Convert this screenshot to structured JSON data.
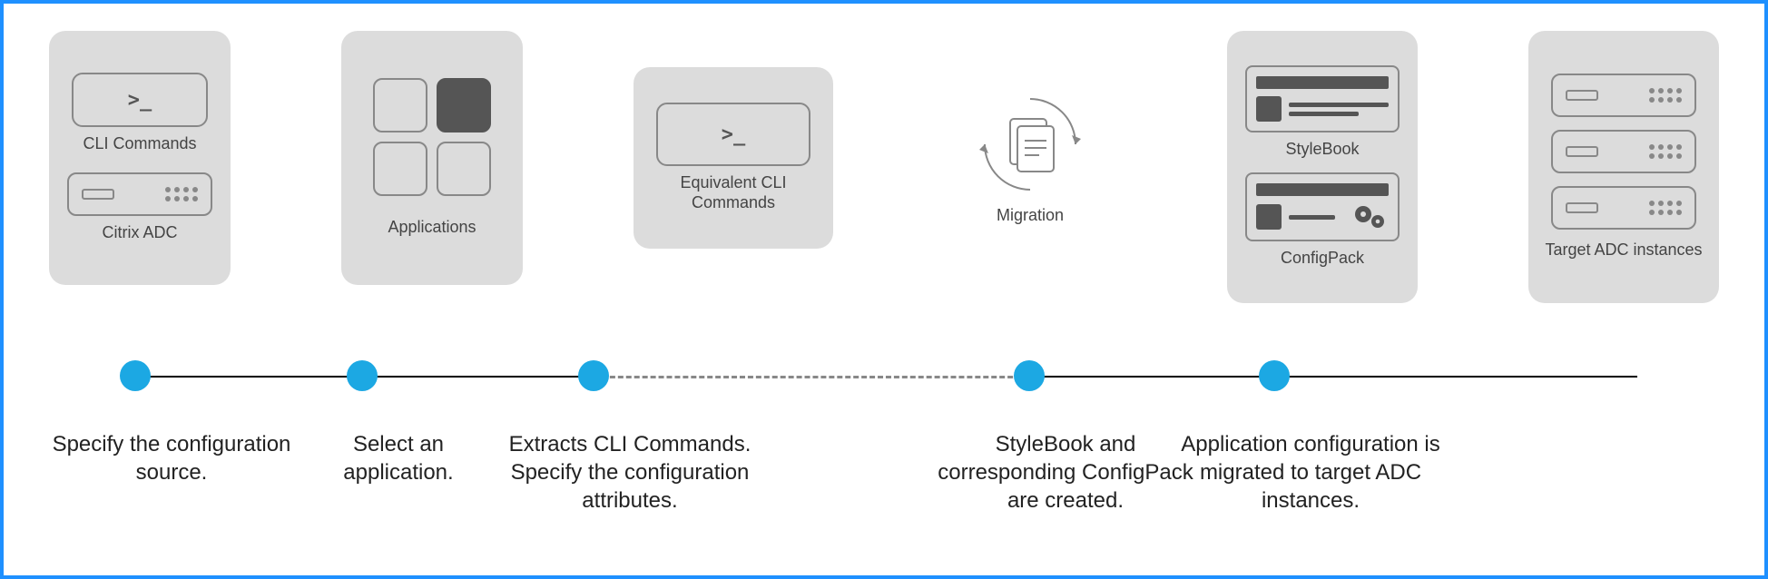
{
  "cards": {
    "cli_label": "CLI Commands",
    "citrix_label": "Citrix ADC",
    "applications_label": "Applications",
    "equiv_cli_label": "Equivalent CLI Commands",
    "migration_label": "Migration",
    "stylebook_label": "StyleBook",
    "configpack_label": "ConfigPack",
    "target_label": "Target ADC instances"
  },
  "prompt_glyph": ">_",
  "steps": {
    "s1": "Specify the configuration source.",
    "s2": "Select an application.",
    "s3": "Extracts CLI Commands. Specify the configuration attributes.",
    "s4": "StyleBook and corresponding ConfigPack are created.",
    "s5": "Application configuration is migrated to target ADC instances."
  }
}
